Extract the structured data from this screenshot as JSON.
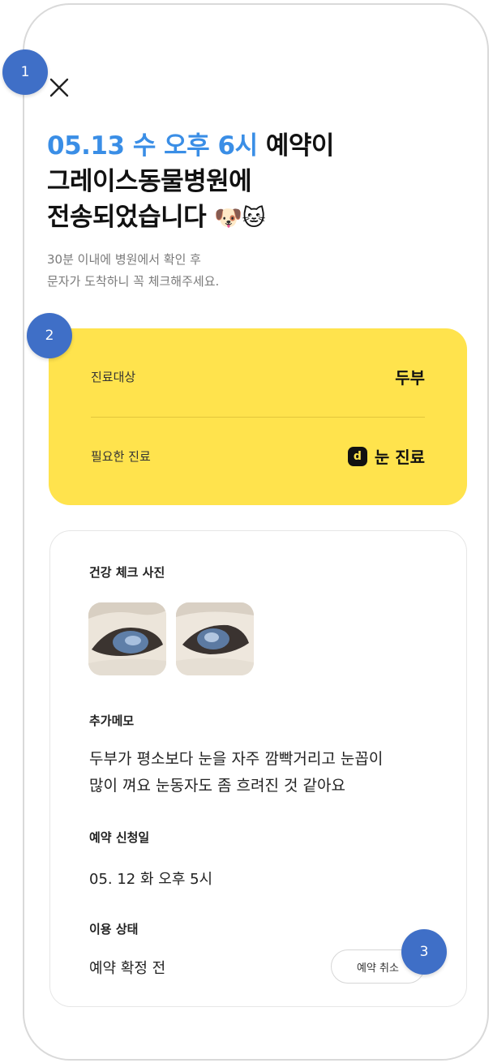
{
  "markers": [
    "1",
    "2",
    "3"
  ],
  "header": {
    "close_icon": "close-icon"
  },
  "headline": {
    "accent": "05.13 수 오후 6시",
    "line1_rest": " 예약이",
    "line2": "그레이스동물병원에",
    "line3": "전송되었습니다",
    "emoji": "🐶🐱"
  },
  "subtext": {
    "line1": "30분 이내에 병원에서 확인 후",
    "line2": "문자가 도착하니 꼭 체크해주세요."
  },
  "summary": {
    "patient_label": "진료대상",
    "patient_value": "두부",
    "treatment_label": "필요한 진료",
    "treatment_badge": "d",
    "treatment_value": "눈 진료"
  },
  "details": {
    "photos_title": "건강 체크 사진",
    "memo_title": "추가메모",
    "memo_line1": "두부가 평소보다 눈을 자주 깜빡거리고 눈꼽이",
    "memo_line2": "많이 껴요 눈동자도 좀 흐려진 것 같아요",
    "request_date_title": "예약 신청일",
    "request_date_value": "05. 12 화 오후 5시",
    "status_title": "이용 상태",
    "status_value": "예약 확정 전",
    "cancel_label": "예약 취소"
  },
  "colors": {
    "accent_blue": "#3a8ee6",
    "card_yellow": "#ffe34d",
    "marker_blue": "#3f6fc7"
  }
}
